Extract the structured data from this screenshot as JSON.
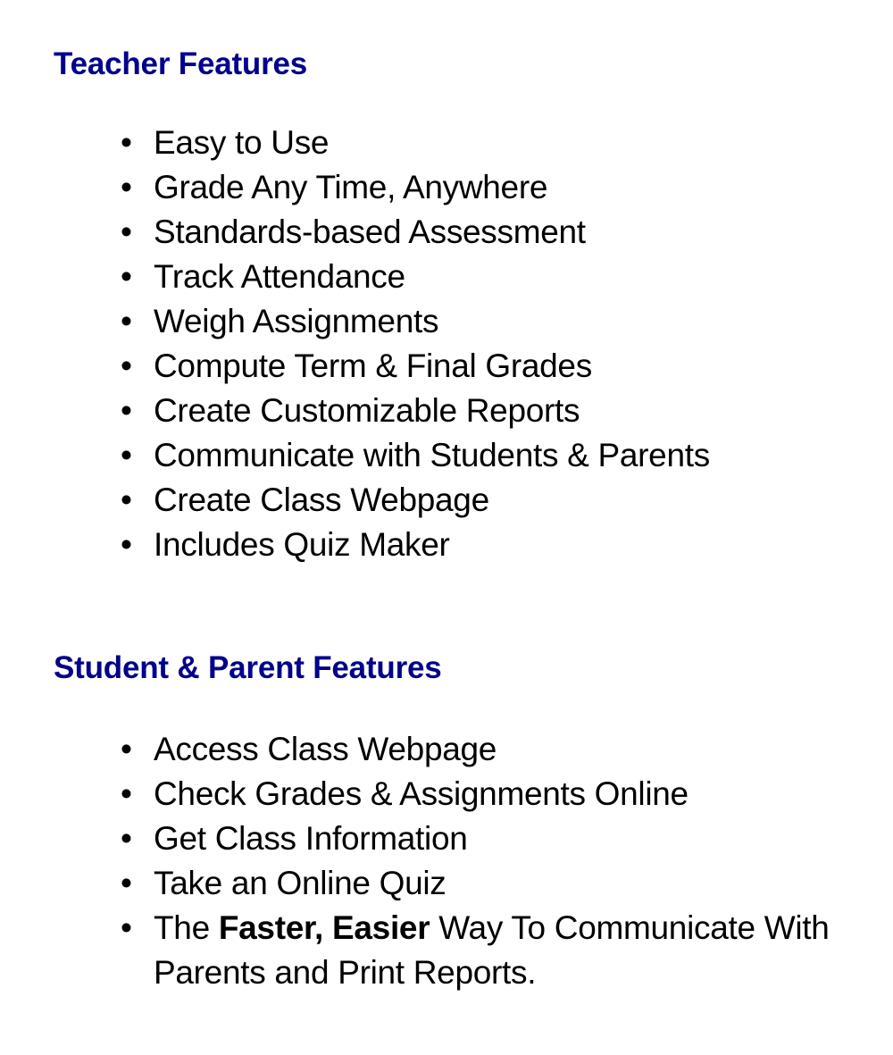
{
  "colors": {
    "background": "#ffffff",
    "heading": "#00008b",
    "body_text": "#000000",
    "bullet": "#000000"
  },
  "bullet_glyph": "•",
  "sections": [
    {
      "id": "teacher-features",
      "heading": "Teacher Features",
      "items": [
        {
          "text": "Easy to Use"
        },
        {
          "text": "Grade Any Time, Anywhere"
        },
        {
          "text": "Standards-based Assessment"
        },
        {
          "text": "Track Attendance"
        },
        {
          "text": "Weigh Assignments"
        },
        {
          "text": "Compute Term & Final Grades"
        },
        {
          "text": "Create Customizable Reports"
        },
        {
          "text": "Communicate with Students & Parents"
        },
        {
          "text": "Create Class Webpage"
        },
        {
          "text": "Includes Quiz Maker"
        }
      ]
    },
    {
      "id": "student-parent-features",
      "heading": "Student & Parent Features",
      "items": [
        {
          "text": "Access Class Webpage"
        },
        {
          "text": "Check Grades & Assignments Online"
        },
        {
          "text": "Get Class Information"
        },
        {
          "text": "Take an Online Quiz"
        },
        {
          "rich": true,
          "text": "The Faster, Easier Way To Communicate With Parents and Print Reports.",
          "parts": [
            {
              "text": "The ",
              "bold": false
            },
            {
              "text": "Faster, Easier",
              "bold": true
            },
            {
              "text": " Way To Communicate With Parents and Print Reports.",
              "bold": false
            }
          ]
        }
      ]
    }
  ]
}
